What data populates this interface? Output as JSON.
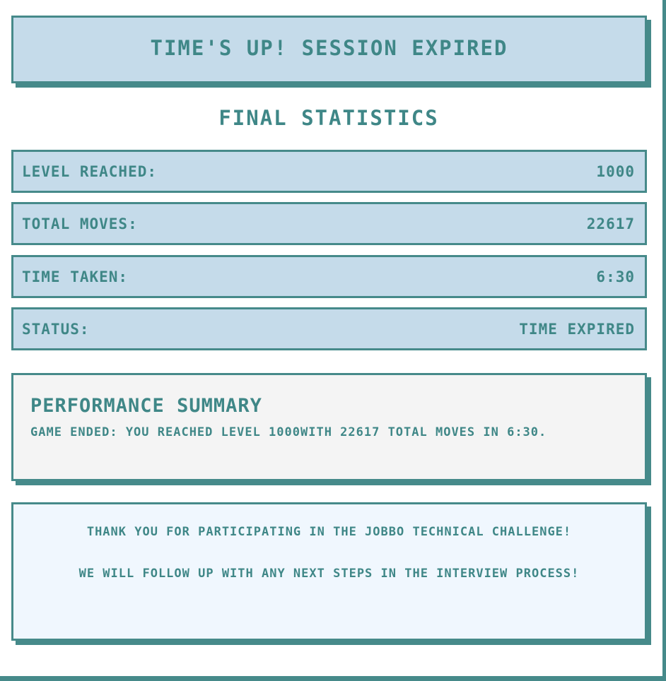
{
  "banner": {
    "title": "TIME'S UP! SESSION EXPIRED"
  },
  "final_statistics": {
    "heading": "FINAL STATISTICS",
    "rows": [
      {
        "label": "LEVEL REACHED:",
        "value": "1000"
      },
      {
        "label": "TOTAL MOVES:",
        "value": "22617"
      },
      {
        "label": "TIME TAKEN:",
        "value": "6:30"
      },
      {
        "label": "STATUS:",
        "value": "TIME EXPIRED"
      }
    ]
  },
  "performance_summary": {
    "title": "PERFORMANCE SUMMARY",
    "text": "GAME ENDED: YOU REACHED LEVEL 1000WITH 22617 TOTAL MOVES IN 6:30."
  },
  "thanks": {
    "line1": "THANK YOU FOR PARTICIPATING IN THE JOBBO TECHNICAL CHALLENGE!",
    "line2": "WE WILL FOLLOW UP WITH ANY NEXT STEPS IN THE INTERVIEW PROCESS!"
  },
  "colors": {
    "accent": "#468a8a",
    "text": "#3f8787",
    "stat_bg": "#c5dbea",
    "summary_bg": "#f4f4f4",
    "thanks_bg": "#f0f7fe"
  }
}
